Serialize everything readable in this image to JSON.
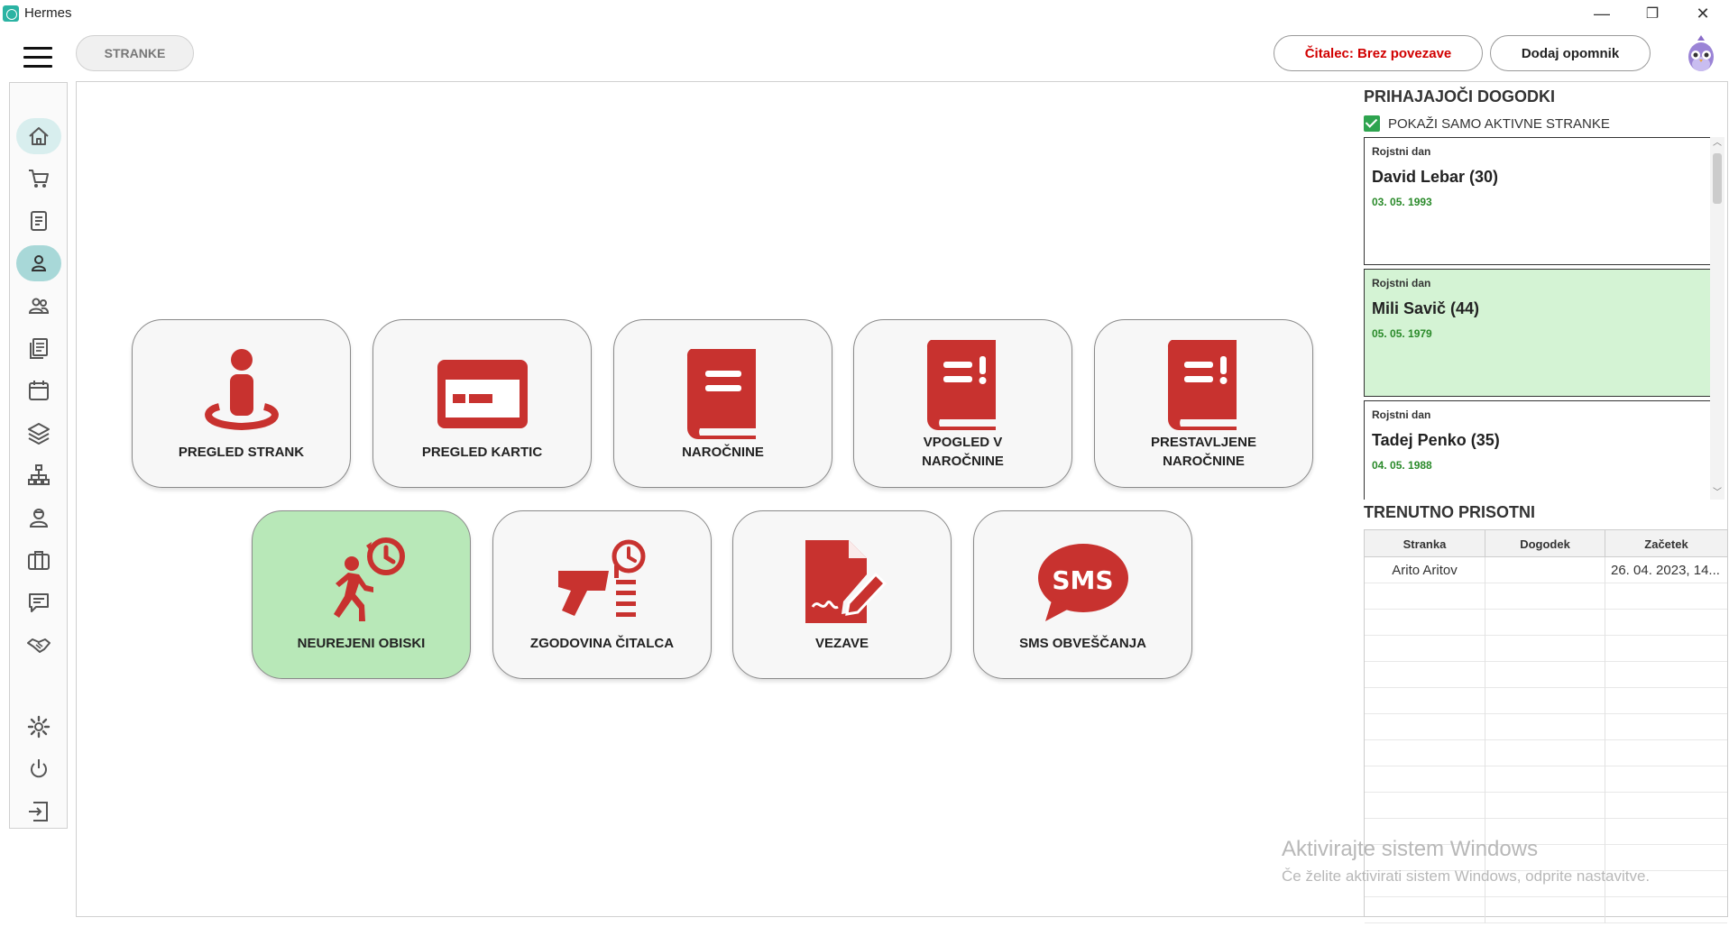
{
  "window": {
    "title": "Hermes",
    "controls": {
      "minimize": "—",
      "maximize": "❐",
      "close": "✕"
    }
  },
  "toolbar": {
    "stranke_label": "STRANKE",
    "citalec_label": "Čitalec: Brez povezave",
    "opomnik_label": "Dodaj opomnik"
  },
  "colors": {
    "accent_red": "#c8322f",
    "tile_green": "#b8e8b8",
    "status_red": "#d10000",
    "date_green": "#2a8a2a"
  },
  "sidebar": {
    "items": [
      {
        "icon": "home-icon"
      },
      {
        "icon": "cart-icon"
      },
      {
        "icon": "document-icon"
      },
      {
        "icon": "person-icon",
        "active": true
      },
      {
        "icon": "people-icon"
      },
      {
        "icon": "list-icon"
      },
      {
        "icon": "calendar-icon"
      },
      {
        "icon": "layers-icon"
      },
      {
        "icon": "hierarchy-icon"
      },
      {
        "icon": "user-badge-icon"
      },
      {
        "icon": "briefcase-icon"
      },
      {
        "icon": "chat-icon"
      },
      {
        "icon": "handshake-icon"
      },
      {
        "icon": "gear-icon"
      },
      {
        "icon": "power-icon"
      },
      {
        "icon": "logout-icon"
      }
    ]
  },
  "tiles": [
    {
      "label": "PREGLED STRANK",
      "icon": "person-location-icon"
    },
    {
      "label": "PREGLED KARTIC",
      "icon": "card-icon"
    },
    {
      "label": "NAROČNINE",
      "icon": "book-icon"
    },
    {
      "label": "VPOGLED V\nNAROČNINE",
      "icon": "book-alert-icon"
    },
    {
      "label": "PRESTAVLJENE\nNAROČNINE",
      "icon": "book-alert-icon"
    },
    {
      "label": "NEUREJENI OBISKI",
      "icon": "walking-history-icon",
      "highlighted": true
    },
    {
      "label": "ZGODOVINA ČITALCA",
      "icon": "scanner-history-icon"
    },
    {
      "label": "VEZAVE",
      "icon": "signature-icon"
    },
    {
      "label": "SMS OBVEŠČANJA",
      "icon": "sms-icon",
      "icon_text": "SMS"
    }
  ],
  "events": {
    "title": "PRIHAJAJOČI DOGODKI",
    "filter_label": "POKAŽI SAMO AKTIVNE STRANKE",
    "filter_checked": true,
    "items": [
      {
        "type": "Rojstni dan",
        "name": "David Lebar (30)",
        "date": "03. 05. 1993"
      },
      {
        "type": "Rojstni dan",
        "name": "Mili Savič (44)",
        "date": "05. 05. 1979",
        "highlighted": true
      },
      {
        "type": "Rojstni dan",
        "name": "Tadej Penko (35)",
        "date": "04. 05. 1988"
      }
    ]
  },
  "presence": {
    "title": "TRENUTNO PRISOTNI",
    "columns": [
      "Stranka",
      "Dogodek",
      "Začetek"
    ],
    "rows": [
      {
        "stranka": "Arito Aritov",
        "dogodek": "",
        "zacetek": "26. 04. 2023, 14..."
      }
    ]
  },
  "watermark": {
    "line1": "Aktivirajte sistem Windows",
    "line2": "Če želite aktivirati sistem Windows, odprite nastavitve."
  }
}
